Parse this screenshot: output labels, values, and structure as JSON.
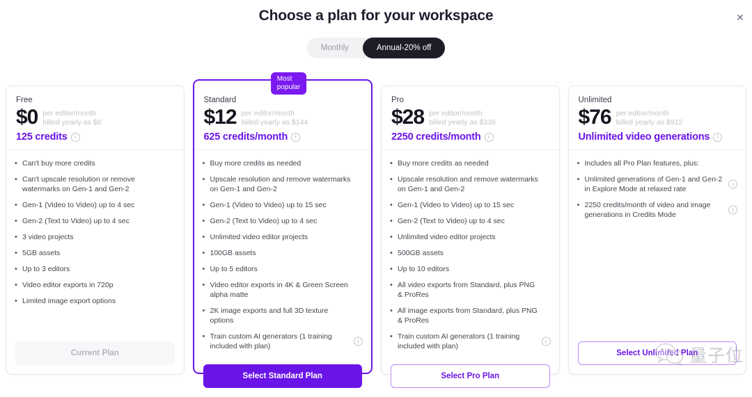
{
  "header": {
    "title": "Choose a plan for your workspace",
    "close_label": "✕"
  },
  "billing_toggle": {
    "monthly_label": "Monthly",
    "annual_label": "Annual-20% off",
    "selected": "Annual-20% off"
  },
  "badge": {
    "text": "Most\npopular"
  },
  "icons": {
    "info": "i",
    "bullet": "•"
  },
  "colors": {
    "accent": "#6a14e8",
    "badge": "#7a19f0",
    "toggle_active_bg": "#1d1d28",
    "muted_text": "#c2c2cc"
  },
  "plans": [
    {
      "name": "Free",
      "price": "$0",
      "per": "per editor/month",
      "billed": "billed yearly as $0",
      "credits": "125 credits",
      "features": [
        {
          "text": "Can't buy more credits",
          "info": false
        },
        {
          "text": "Can't upscale resolution or remove watermarks on Gen-1 and Gen-2",
          "info": false
        },
        {
          "text": "Gen-1 (Video to Video) up to 4 sec",
          "info": false
        },
        {
          "text": "Gen-2 (Text to Video) up to 4 sec",
          "info": false
        },
        {
          "text": "3 video projects",
          "info": false
        },
        {
          "text": "5GB assets",
          "info": false
        },
        {
          "text": "Up to 3 editors",
          "info": false
        },
        {
          "text": "Video editor exports in 720p",
          "info": false
        },
        {
          "text": "Limited image export options",
          "info": false
        }
      ],
      "cta": "Current Plan",
      "cta_style": "disabled",
      "featured": false
    },
    {
      "name": "Standard",
      "price": "$12",
      "per": "per editor/month",
      "billed": "billed yearly as $144",
      "credits": "625 credits/month",
      "features": [
        {
          "text": "Buy more credits as needed",
          "info": false
        },
        {
          "text": "Upscale resolution and remove watermarks on Gen-1 and Gen-2",
          "info": false
        },
        {
          "text": "Gen-1 (Video to Video) up to 15 sec",
          "info": false
        },
        {
          "text": "Gen-2 (Text to Video) up to 4 sec",
          "info": false
        },
        {
          "text": "Unlimited video editor projects",
          "info": false
        },
        {
          "text": "100GB assets",
          "info": false
        },
        {
          "text": "Up to 5 editors",
          "info": false
        },
        {
          "text": "Video editor exports in 4K & Green Screen alpha matte",
          "info": false
        },
        {
          "text": "2K image exports and full 3D texture options",
          "info": false
        },
        {
          "text": "Train custom AI generators (1 training included with plan)",
          "info": true
        }
      ],
      "cta": "Select Standard Plan",
      "cta_style": "primary",
      "featured": true
    },
    {
      "name": "Pro",
      "price": "$28",
      "per": "per editor/month",
      "billed": "billed yearly as $336",
      "credits": "2250 credits/month",
      "features": [
        {
          "text": "Buy more credits as needed",
          "info": false
        },
        {
          "text": "Upscale resolution and remove watermarks on Gen-1 and Gen-2",
          "info": false
        },
        {
          "text": "Gen-1 (Video to Video) up to 15 sec",
          "info": false
        },
        {
          "text": "Gen-2 (Text to Video) up to 4 sec",
          "info": false
        },
        {
          "text": "Unlimited video editor projects",
          "info": false
        },
        {
          "text": "500GB assets",
          "info": false
        },
        {
          "text": "Up to 10 editors",
          "info": false
        },
        {
          "text": "All video exports from Standard, plus PNG & ProRes",
          "info": false
        },
        {
          "text": "All image exports from Standard, plus PNG & ProRes",
          "info": false
        },
        {
          "text": "Train custom AI generators (1 training included with plan)",
          "info": true
        }
      ],
      "cta": "Select Pro Plan",
      "cta_style": "outline",
      "featured": false
    },
    {
      "name": "Unlimited",
      "price": "$76",
      "per": "per editor/month",
      "billed": "billed yearly as $912",
      "credits": "Unlimited video generations",
      "features": [
        {
          "text": "Includes all Pro Plan features, plus:",
          "info": false
        },
        {
          "text": "Unlimited generations of Gen-1 and Gen-2 in Explore Mode at relaxed rate",
          "info": true
        },
        {
          "text": "2250 credits/month of video and image generations in Credits Mode",
          "info": true
        }
      ],
      "cta": "Select Unlimited Plan",
      "cta_style": "outline",
      "featured": false
    }
  ],
  "watermark": {
    "text": "量子位"
  }
}
